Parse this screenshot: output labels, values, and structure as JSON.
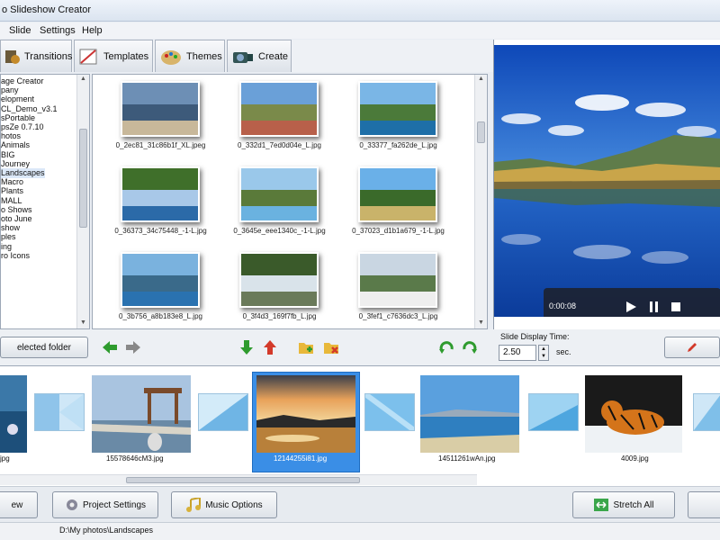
{
  "window": {
    "title": "o Slideshow Creator"
  },
  "menu": {
    "item_slide": "Slide",
    "item_settings": "Settings",
    "item_help": "Help"
  },
  "tabs": [
    {
      "label": "Transitions",
      "icon": "transitions-icon"
    },
    {
      "label": "Templates",
      "icon": "templates-icon"
    },
    {
      "label": "Themes",
      "icon": "themes-icon"
    },
    {
      "label": "Create",
      "icon": "create-icon"
    }
  ],
  "folder_tree": {
    "items": [
      "age Creator",
      "pany",
      "elopment",
      "CL_Demo_v3.1",
      "sPortable",
      "psZe 0.7.10",
      "hotos",
      "Animals",
      "BIG",
      "Journey",
      "Landscapes",
      "Macro",
      "Plants",
      "MALL",
      "o Shows",
      "oto June",
      "show",
      "ples",
      "ing",
      "ro Icons"
    ],
    "selected_index": 10,
    "button_label": "elected folder"
  },
  "thumbnails": [
    {
      "caption": "0_2ec81_31c86b1f_XL.jpeg"
    },
    {
      "caption": "0_332d1_7ed0d04e_L.jpg"
    },
    {
      "caption": "0_33377_fa262de_L.jpg"
    },
    {
      "caption": "0_36373_34c75448_-1-L.jpg"
    },
    {
      "caption": "0_3645e_eee1340c_-1-L.jpg"
    },
    {
      "caption": "0_37023_d1b1a679_-1-L.jpg"
    },
    {
      "caption": "0_3b756_a8b183e8_L.jpg"
    },
    {
      "caption": "0_3f4d3_169f7fb_L.jpg"
    },
    {
      "caption": "0_3fef1_c7636dc3_L.jpg"
    }
  ],
  "player": {
    "time": "0:00:08"
  },
  "slide_display": {
    "label": "Slide Display Time:",
    "value": "2.50",
    "unit": "sec."
  },
  "storyboard": {
    "slides": [
      {
        "filename": "jpg"
      },
      {
        "filename": "15578646cM3.jpg"
      },
      {
        "filename": "12144255i81.jpg",
        "selected": true
      },
      {
        "filename": "14511261wAn.jpg"
      },
      {
        "filename": "4009.jpg"
      }
    ]
  },
  "bottom": {
    "preview_label": "ew",
    "project_settings_label": "Project Settings",
    "music_options_label": "Music Options",
    "stretch_all_label": "Stretch All"
  },
  "status": {
    "path": "D:\\My photos\\Landscapes"
  },
  "colors": {
    "accent": "#2b7cd3",
    "selection": "#3a8ee6",
    "arrow_green": "#2e9b2e",
    "arrow_red": "#d33a2a"
  }
}
